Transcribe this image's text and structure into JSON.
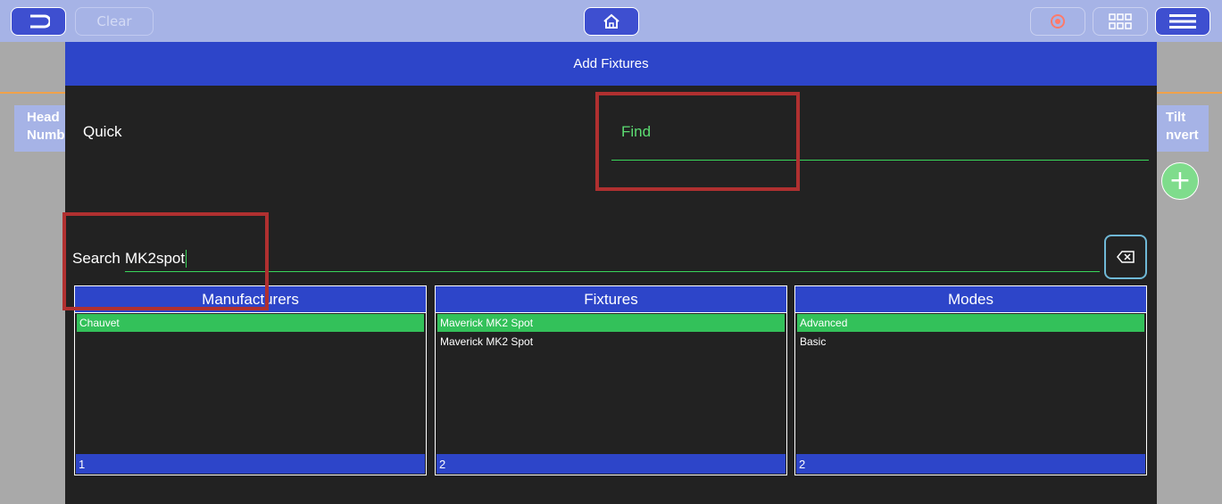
{
  "toolbar": {
    "back_icon": "undo-arrow-icon",
    "clear_label": "Clear",
    "home_icon": "home-icon",
    "record_icon": "record-icon",
    "grid_icon": "grid-icon",
    "menu_icon": "hamburger-menu-icon"
  },
  "background": {
    "columns": {
      "left": [
        "Head",
        "Numb"
      ],
      "right": [
        "Tilt",
        "nvert"
      ]
    },
    "add_label": "+"
  },
  "dialog": {
    "title": "Add Fixtures",
    "quick_label": "Quick",
    "find_label": "Find",
    "search_label": "Search",
    "search_value": "MK2spot",
    "clear_search_icon": "backspace-icon",
    "panels": [
      {
        "header": "Manufacturers",
        "items": [
          {
            "label": "Chauvet",
            "selected": true
          }
        ],
        "count": "1"
      },
      {
        "header": "Fixtures",
        "items": [
          {
            "label": "Maverick MK2 Spot",
            "selected": true
          },
          {
            "label": "Maverick MK2 Spot",
            "selected": false
          }
        ],
        "count": "2"
      },
      {
        "header": "Modes",
        "items": [
          {
            "label": "Advanced",
            "selected": true
          },
          {
            "label": "Basic",
            "selected": false
          }
        ],
        "count": "2"
      }
    ]
  },
  "colors": {
    "toolbar_bg": "#a6b3e6",
    "dialog_title_bg": "#2d45c9",
    "dialog_bg": "#222222",
    "accent_green": "#33c15a",
    "annotation_red": "#b03030"
  }
}
